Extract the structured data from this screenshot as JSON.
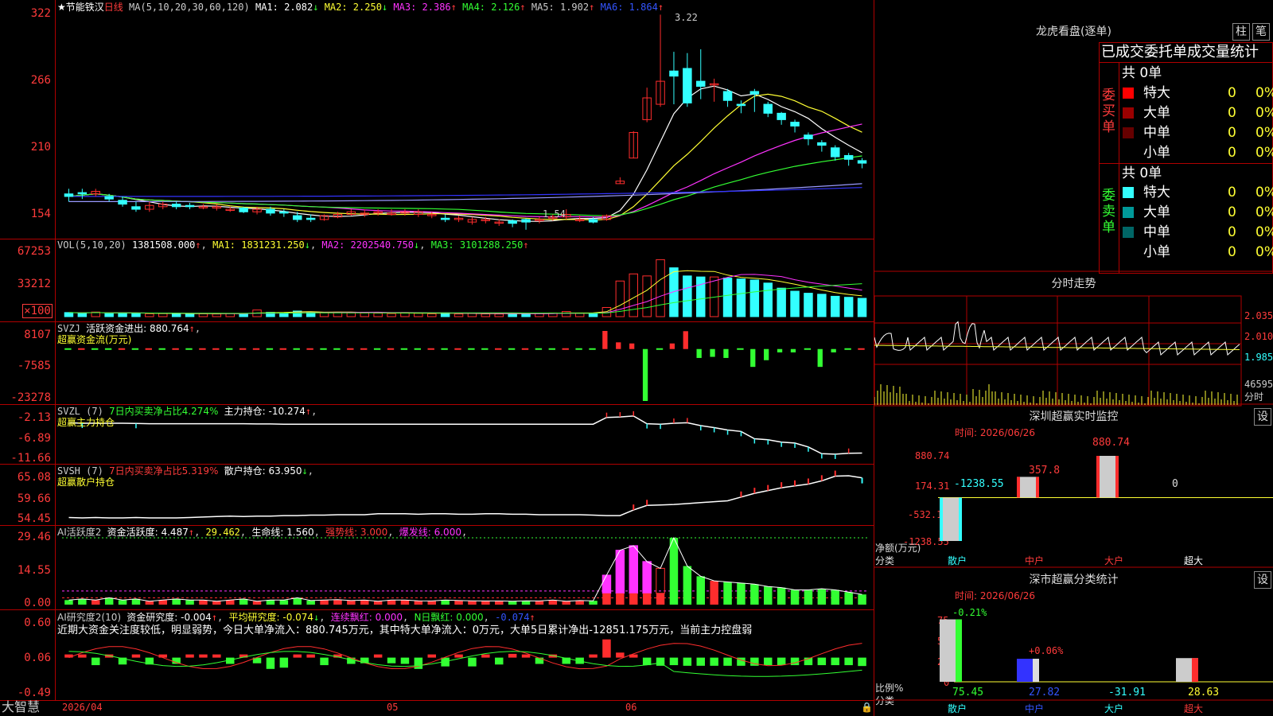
{
  "colors": {
    "up": "#ff2d2d",
    "down": "#33ffff",
    "ma1": "#ffffff",
    "ma2": "#ffff33",
    "ma3": "#ff33ff",
    "ma4": "#33ff33",
    "ma5": "#9999ff",
    "ma6": "#3333ff",
    "grid": "#b00000",
    "yellow": "#ffff00",
    "green": "#33ff33",
    "magenta": "#ff33ff",
    "white": "#ffffff"
  },
  "kline": {
    "stock_name": "★节能铁汉",
    "period": "日线",
    "ma_params": "MA(5,10,20,30,60,120)",
    "ma": [
      {
        "label": "MA1: 2.082",
        "arrow": "↓",
        "color": "#ffffff"
      },
      {
        "label": "MA2: 2.250",
        "arrow": "↓",
        "color": "#ffff33"
      },
      {
        "label": "MA3: 2.386",
        "arrow": "↑",
        "color": "#ff33ff"
      },
      {
        "label": "MA4: 2.126",
        "arrow": "↑",
        "color": "#33ff33"
      },
      {
        "label": "MA5: 1.902",
        "arrow": "↑",
        "color": "#cccccc"
      },
      {
        "label": "MA6: 1.864",
        "arrow": "↑",
        "color": "#3333ff"
      }
    ],
    "axis": [
      "322",
      "266",
      "210",
      "154"
    ],
    "high_label": "3.22",
    "low_label": "1.54"
  },
  "vol": {
    "params": "VOL(5,10,20)",
    "value": "1381508.000",
    "ma1": "MA1: 1831231.250",
    "ma1_arrow": "↓",
    "ma2": "MA2: 2202540.750",
    "ma2_arrow": "↓",
    "ma3": "MA3: 3101288.250",
    "ma3_arrow": "↑",
    "axis": [
      "67253",
      "33212",
      "×100"
    ]
  },
  "svzj": {
    "params": "SVZJ",
    "label": "活跃资金进出: 880.764",
    "arrow": "↑",
    "sub": "超赢资金流(万元)",
    "axis": [
      "8107",
      "-7585",
      "-23278"
    ]
  },
  "svzl": {
    "params": "SVZL (7)",
    "ratio": "7日内买卖净占比4.274%",
    "label": "主力持仓: -10.274",
    "arrow": "↑",
    "sub": "超赢主力持仓",
    "axis": [
      "-2.13",
      "-6.89",
      "-11.66"
    ]
  },
  "svsh": {
    "params": "SVSH (7)",
    "ratio": "7日内买卖净占比5.319%",
    "label": "散户持仓: 63.950",
    "arrow": "↓",
    "sub": "超赢散户持仓",
    "axis": [
      "65.08",
      "59.66",
      "54.45"
    ]
  },
  "ai1": {
    "params": "AI活跃度2",
    "label": "资金活跃度: 4.487",
    "arrow": "↑",
    "v2": "29.462",
    "life": "生命线: 1.560",
    "strong": "强势线: 3.000",
    "burst": "爆发线: 6.000",
    "axis": [
      "29.46",
      "14.55",
      "0.00"
    ]
  },
  "ai2": {
    "params": "AI研究度2(10)",
    "label": "资金研究度: -0.004",
    "arrow": "↑",
    "avg": "平均研究度: -0.074",
    "arrow2": "↓",
    "red": "连续飘红: 0.000",
    "nred": "N日飘红: 0.000",
    "last": "-0.074",
    "arrow3": "↑",
    "text": "近期大资金关注度较低，明显弱势，今日大单净流入：880.745万元，其中特大单净流入：0万元，大单5日累计净出-12851.175万元，当前主力控盘弱",
    "axis": [
      "0.60",
      "0.06",
      "-0.49"
    ]
  },
  "xaxis": {
    "brand": "大智慧",
    "date1": "2026/04",
    "date2": "05",
    "date3": "06"
  },
  "chart_data": [
    {
      "type": "candlestick",
      "title": "节能铁汉 日线",
      "ylim": [
        1.54,
        3.22
      ],
      "open": [
        1.82,
        1.83,
        1.82,
        1.8,
        1.77,
        1.72,
        1.7,
        1.72,
        1.74,
        1.73,
        1.72,
        1.71,
        1.7,
        1.71,
        1.68,
        1.7,
        1.68,
        1.65,
        1.63,
        1.62,
        1.64,
        1.66,
        1.67,
        1.68,
        1.66,
        1.67,
        1.66,
        1.65,
        1.63,
        1.62,
        1.6,
        1.62,
        1.6,
        1.61,
        1.62,
        1.62,
        1.64,
        1.64,
        1.62,
        1.62,
        1.62,
        1.9,
        2.1,
        2.4,
        2.52,
        2.78,
        2.8,
        2.7,
        2.68,
        2.62,
        2.52,
        2.62,
        2.52,
        2.45,
        2.38,
        2.28,
        2.22,
        2.18,
        2.12,
        2.08
      ],
      "close": [
        1.8,
        1.82,
        1.84,
        1.78,
        1.74,
        1.7,
        1.73,
        1.74,
        1.72,
        1.72,
        1.72,
        1.72,
        1.7,
        1.68,
        1.7,
        1.67,
        1.67,
        1.62,
        1.62,
        1.65,
        1.66,
        1.68,
        1.67,
        1.68,
        1.67,
        1.68,
        1.68,
        1.66,
        1.62,
        1.63,
        1.62,
        1.62,
        1.6,
        1.59,
        1.6,
        1.62,
        1.64,
        1.66,
        1.62,
        1.6,
        1.65,
        1.92,
        2.3,
        2.57,
        2.7,
        2.74,
        2.53,
        2.66,
        2.68,
        2.55,
        2.51,
        2.6,
        2.45,
        2.4,
        2.35,
        2.25,
        2.2,
        2.11,
        2.09,
        2.06
      ],
      "high": [
        1.86,
        1.86,
        1.86,
        1.82,
        1.8,
        1.76,
        1.76,
        1.76,
        1.76,
        1.75,
        1.74,
        1.74,
        1.72,
        1.72,
        1.72,
        1.72,
        1.7,
        1.68,
        1.66,
        1.66,
        1.68,
        1.7,
        1.7,
        1.7,
        1.7,
        1.7,
        1.7,
        1.68,
        1.66,
        1.65,
        1.64,
        1.64,
        1.62,
        1.62,
        1.63,
        1.64,
        1.66,
        1.7,
        1.65,
        1.64,
        1.66,
        1.95,
        2.31,
        2.65,
        3.22,
        2.93,
        2.92,
        2.95,
        2.72,
        2.64,
        2.55,
        2.64,
        2.54,
        2.46,
        2.4,
        2.3,
        2.24,
        2.2,
        2.14,
        2.1
      ],
      "low": [
        1.76,
        1.78,
        1.8,
        1.76,
        1.72,
        1.68,
        1.68,
        1.7,
        1.7,
        1.7,
        1.7,
        1.69,
        1.68,
        1.67,
        1.66,
        1.65,
        1.64,
        1.6,
        1.6,
        1.61,
        1.63,
        1.65,
        1.64,
        1.65,
        1.65,
        1.65,
        1.64,
        1.63,
        1.6,
        1.6,
        1.58,
        1.59,
        1.57,
        1.56,
        1.54,
        1.59,
        1.61,
        1.62,
        1.6,
        1.59,
        1.61,
        1.9,
        2.1,
        2.38,
        2.5,
        2.52,
        2.5,
        2.56,
        2.54,
        2.5,
        2.45,
        2.46,
        2.42,
        2.36,
        2.3,
        2.2,
        2.15,
        2.08,
        2.04,
        2.02
      ]
    },
    {
      "type": "bar",
      "title": "VOL(5,10,20)",
      "ylim": [
        0,
        67253
      ],
      "values": [
        4000,
        3500,
        4500,
        3000,
        3800,
        3200,
        2800,
        3000,
        3300,
        2500,
        2800,
        2600,
        3100,
        2900,
        6500,
        4200,
        3800,
        5500,
        4600,
        3900,
        4400,
        3700,
        3600,
        3400,
        3000,
        4000,
        3300,
        2800,
        3700,
        2600,
        3200,
        2700,
        2600,
        3000,
        2800,
        3400,
        3600,
        5000,
        3200,
        3500,
        9000,
        35000,
        42000,
        40000,
        56000,
        48000,
        40000,
        39000,
        39000,
        38000,
        37000,
        36000,
        33000,
        28000,
        25000,
        23000,
        22000,
        20000,
        19000,
        18000
      ]
    },
    {
      "type": "bar",
      "title": "超赢资金流(万元)",
      "ylim": [
        -23278,
        8107
      ],
      "values": [
        -700,
        700,
        -700,
        -700,
        700,
        -700,
        700,
        -700,
        700,
        -700,
        700,
        700,
        -700,
        700,
        700,
        -700,
        700,
        -700,
        700,
        -700,
        -700,
        700,
        700,
        -700,
        700,
        -700,
        -700,
        700,
        -700,
        700,
        -700,
        -700,
        700,
        -700,
        700,
        -700,
        -700,
        700,
        -700,
        -700,
        8107,
        3000,
        2500,
        -23278,
        -800,
        2500,
        8000,
        -4000,
        -3500,
        -4000,
        -900,
        -8000,
        -5000,
        -1500,
        -1500,
        -800,
        -8000,
        -1500,
        -800,
        880
      ]
    },
    {
      "type": "line",
      "title": "超赢主力持仓",
      "ylim": [
        -11.66,
        -2.13
      ],
      "values": [
        -4.0,
        -4.1,
        -4.1,
        -4.1,
        -4.1,
        -4.15,
        -4.2,
        -4.2,
        -4.2,
        -4.2,
        -4.2,
        -4.2,
        -4.2,
        -4.2,
        -4.25,
        -4.25,
        -4.3,
        -4.3,
        -4.3,
        -4.3,
        -4.3,
        -4.3,
        -4.3,
        -4.3,
        -4.3,
        -4.3,
        -4.3,
        -4.3,
        -4.3,
        -4.3,
        -4.3,
        -4.3,
        -4.3,
        -4.3,
        -4.3,
        -4.3,
        -4.3,
        -4.3,
        -4.3,
        -4.3,
        -2.9,
        -2.8,
        -2.6,
        -4.2,
        -4.3,
        -4.1,
        -4.0,
        -4.6,
        -5.0,
        -5.5,
        -5.8,
        -7.3,
        -7.5,
        -8.0,
        -8.2,
        -9.0,
        -10.4,
        -10.5,
        -10.3,
        -10.27
      ]
    },
    {
      "type": "line",
      "title": "超赢散户持仓",
      "ylim": [
        54.45,
        65.08
      ],
      "values": [
        55.4,
        55.3,
        55.4,
        55.3,
        55.3,
        55.4,
        55.3,
        55.3,
        55.3,
        55.4,
        55.5,
        55.6,
        55.7,
        55.6,
        55.7,
        55.7,
        55.8,
        55.8,
        55.9,
        55.9,
        56.0,
        56.0,
        56.0,
        56.2,
        56.2,
        56.2,
        56.1,
        56.2,
        56.2,
        56.1,
        56.1,
        56.2,
        56.2,
        56.1,
        56.1,
        56.0,
        56.0,
        56.0,
        56.0,
        55.9,
        55.8,
        55.8,
        57.0,
        58.0,
        58.1,
        58.2,
        58.4,
        58.6,
        58.8,
        59.0,
        59.8,
        60.6,
        61.2,
        61.8,
        62.2,
        62.6,
        63.3,
        64.3,
        64.4,
        63.95
      ]
    },
    {
      "type": "bar",
      "title": "AI活跃度2",
      "ylim": [
        0,
        29.46
      ],
      "values": [
        2,
        2.5,
        2,
        3,
        2,
        2.5,
        1.5,
        2,
        2.5,
        2,
        2,
        1.5,
        2,
        2.5,
        1.5,
        2,
        2,
        3,
        1.8,
        2,
        2.2,
        1.8,
        2,
        1.5,
        2,
        2,
        1.7,
        1.6,
        2,
        1.8,
        1.7,
        1.6,
        1.6,
        1.5,
        1.7,
        1.6,
        2,
        1.5,
        1.8,
        1.7,
        13,
        24,
        26,
        19,
        16,
        29.46,
        17,
        12.5,
        10.5,
        10,
        9.5,
        9,
        8,
        7.5,
        6.5,
        6.5,
        7,
        6.5,
        5.5,
        4.487
      ]
    },
    {
      "type": "bar",
      "title": "AI研究度2(10)",
      "ylim": [
        -0.49,
        0.6
      ],
      "values": [
        0.06,
        0.06,
        -0.06,
        0.08,
        -0.05,
        0.04,
        -0.05,
        0.05,
        -0.04,
        0.05,
        0.04,
        0.03,
        -0.04,
        0.04,
        -0.03,
        -0.12,
        -0.1,
        0.05,
        0.04,
        -0.06,
        0.04,
        -0.04,
        -0.03,
        0.03,
        -0.03,
        -0.04,
        -0.12,
        0.04,
        -0.08,
        0.04,
        -0.08,
        0.04,
        -0.05,
        0.12,
        0.1,
        -0.04,
        0.05,
        -0.04,
        -0.04,
        0.04,
        0.35,
        0.14,
        0.06,
        -0.06,
        -0.07,
        -0.06,
        -0.07,
        -0.07,
        -0.07,
        -0.07,
        -0.07,
        -0.07,
        -0.06,
        -0.06,
        -0.06,
        -0.06,
        -0.06,
        -0.06,
        -0.06,
        -0.074
      ]
    }
  ],
  "dragon": {
    "title": "龙虎看盘(逐单)",
    "btn1": "柱",
    "btn2": "笔",
    "header": "已成交委托单成交量统计",
    "buy": {
      "side": "委买单",
      "total": "共 0单",
      "rows": [
        {
          "label": "特大",
          "v": "0",
          "p": "0%",
          "color": "#ff0000"
        },
        {
          "label": "大单",
          "v": "0",
          "p": "0%",
          "color": "#9a0000"
        },
        {
          "label": "中单",
          "v": "0",
          "p": "0%",
          "color": "#660000"
        },
        {
          "label": "小单",
          "v": "0",
          "p": "0%",
          "color": "#000000"
        }
      ]
    },
    "sell": {
      "side": "委卖单",
      "total": "共 0单",
      "rows": [
        {
          "label": "特大",
          "v": "0",
          "p": "0%",
          "color": "#33ffff"
        },
        {
          "label": "大单",
          "v": "0",
          "p": "0%",
          "color": "#009999"
        },
        {
          "label": "中单",
          "v": "0",
          "p": "0%",
          "color": "#006666"
        },
        {
          "label": "小单",
          "v": "0",
          "p": "0%",
          "color": "#000000"
        }
      ]
    }
  },
  "intraday": {
    "title": "分时走势",
    "labels": [
      "2.035",
      "2.010",
      "1.985",
      "46595",
      "分时"
    ]
  },
  "monitor": {
    "title": "深圳超赢实时监控",
    "btn": "设",
    "time": "时间: 2026/06/26",
    "axis": [
      "880.74",
      "174.31",
      "-532.12",
      "-1238.55"
    ],
    "ylabel": "净额(万元)",
    "xlabel": "分类",
    "cats": [
      "散户",
      "中户",
      "大户",
      "超大"
    ],
    "chart": {
      "type": "bar",
      "categories": [
        "散户",
        "中户",
        "大户",
        "超大"
      ],
      "values": [
        -1238.55,
        357.8,
        880.74,
        0
      ],
      "value_labels": [
        "-1238.55",
        "357.8",
        "880.74",
        "0"
      ]
    }
  },
  "stats": {
    "title": "深市超赢分类统计",
    "btn": "设",
    "time": "时间: 2026/06/26",
    "axis": [
      "75",
      "50",
      "25",
      "0"
    ],
    "ylabel": "比例%",
    "xlabel": "分类",
    "cats": [
      "散户",
      "中户",
      "大户",
      "超大"
    ],
    "chart": {
      "type": "bar",
      "categories": [
        "散户",
        "中户",
        "大户",
        "超大"
      ],
      "values": [
        75.45,
        27.82,
        -31.91,
        28.63
      ],
      "value_labels": [
        "75.45",
        "27.82",
        "-31.91",
        "28.63"
      ],
      "change_labels": [
        "-0.21%",
        "+0.06%"
      ]
    }
  }
}
